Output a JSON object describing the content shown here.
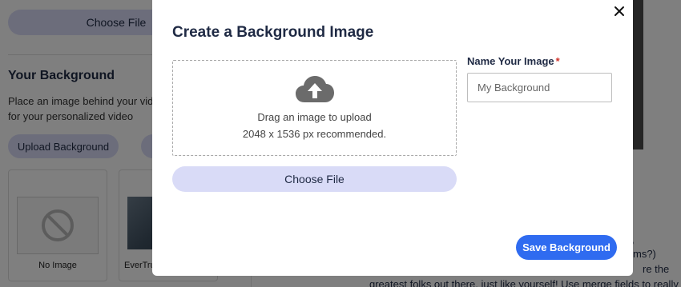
{
  "background_page": {
    "choose_file_label": "Choose File",
    "section_title": "Your Background",
    "section_description": "Place an image behind your video for your personalized video",
    "upload_button_label": "Upload Background",
    "cards": [
      {
        "label": "No Image",
        "icon": "ban-icon"
      },
      {
        "label": "EverTru"
      }
    ],
    "right_text_lines": [
      ",",
      "ms?)",
      "re the",
      "greatest folks out there, just like yourself! Use merge fields to really"
    ]
  },
  "modal": {
    "title": "Create a Background Image",
    "close_icon": "close-icon",
    "dropzone": {
      "icon": "cloud-upload-icon",
      "line1": "Drag an image to upload",
      "line2": "2048 x 1536 px recommended."
    },
    "choose_file_label": "Choose File",
    "name_field": {
      "label": "Name Your Image",
      "required_marker": "*",
      "placeholder": "My Background",
      "value": ""
    },
    "save_button_label": "Save Background"
  },
  "colors": {
    "accent": "#2f6bf0",
    "secondary_button": "#d9dbf7",
    "required": "#d0342c",
    "title_text": "#1f2a44"
  }
}
